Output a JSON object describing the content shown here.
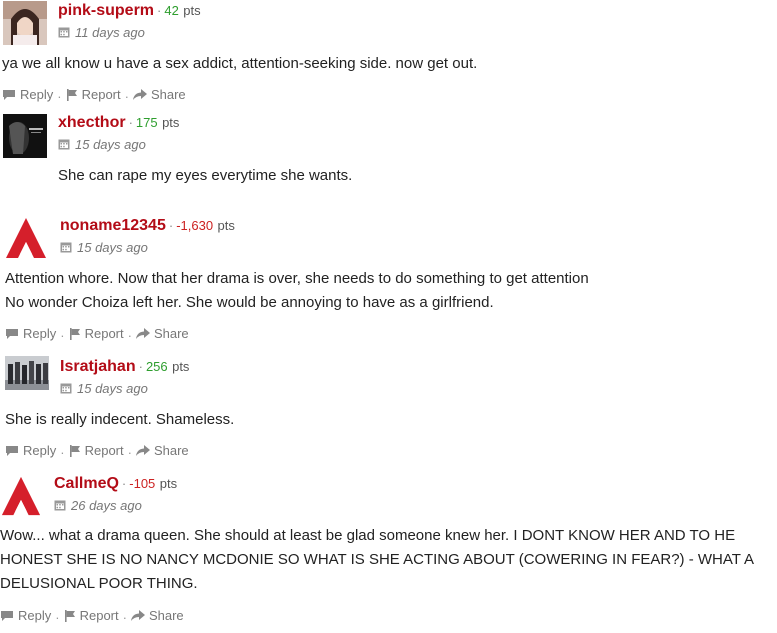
{
  "comments": [
    {
      "username": "pink-superm",
      "points": "42",
      "points_unit": "pts",
      "date": "11 days ago",
      "text": [
        "ya we all know u have a sex addict, attention-seeking side. now get out."
      ],
      "actions": {
        "reply": "Reply",
        "report": "Report",
        "share": "Share"
      }
    },
    {
      "username": "xhecthor",
      "points": "175",
      "points_unit": "pts",
      "date": "15 days ago",
      "text": [
        "She can rape my eyes everytime she wants."
      ]
    },
    {
      "username": "noname12345",
      "points": "-1,630",
      "points_unit": "pts",
      "date": "15 days ago",
      "text": [
        "Attention whore. Now that her drama is over, she needs to do something to get attention",
        "No wonder Choiza left her. She would be annoying to have as a girlfriend."
      ],
      "actions": {
        "reply": "Reply",
        "report": "Report",
        "share": "Share"
      }
    },
    {
      "username": "Isratjahan",
      "points": "256",
      "points_unit": "pts",
      "date": "15 days ago",
      "text": [
        "She is really indecent. Shameless."
      ],
      "actions": {
        "reply": "Reply",
        "report": "Report",
        "share": "Share"
      }
    },
    {
      "username": "CallmeQ",
      "points": "-105",
      "points_unit": "pts",
      "date": "26 days ago",
      "text": [
        "Wow... what a drama queen. She should at least be glad someone knew her. I DONT KNOW HER AND TO HE",
        "HONEST SHE IS NO NANCY MCDONIE SO WHAT IS SHE ACTING ABOUT (COWERING IN FEAR?) - WHAT A",
        "DELUSIONAL POOR THING."
      ],
      "actions": {
        "reply": "Reply",
        "report": "Report",
        "share": "Share"
      }
    }
  ],
  "colors": {
    "username": "#b30c17",
    "points_positive": "#2e9e2e",
    "points_negative": "#cc2222",
    "meta": "#777777"
  },
  "icons": {
    "calendar": "calendar-icon",
    "reply": "speech-bubble-icon",
    "report": "flag-icon",
    "share": "share-arrow-icon",
    "default_avatar": "red-a-logo-icon"
  }
}
